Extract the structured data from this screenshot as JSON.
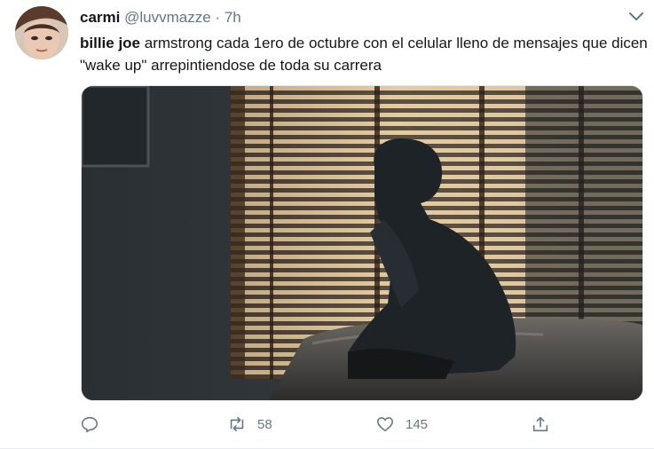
{
  "tweet": {
    "display_name": "carmi",
    "handle": "@luvvmazze",
    "separator": "·",
    "time": "7h",
    "text_bold": "billie joe",
    "text_rest": " armstrong cada 1ero de octubre con el celular lleno de mensajes que dicen \"wake up\" arrepintiendose de toda su carrera",
    "media_description_icon": "photo",
    "actions": {
      "reply": {
        "icon": "reply-icon",
        "count": ""
      },
      "retweet": {
        "icon": "retweet-icon",
        "count": "58"
      },
      "like": {
        "icon": "heart-icon",
        "count": "145"
      },
      "share": {
        "icon": "share-icon",
        "count": ""
      }
    }
  },
  "colors": {
    "text": "#14171a",
    "secondary": "#657786",
    "border": "#e1e8ed"
  }
}
